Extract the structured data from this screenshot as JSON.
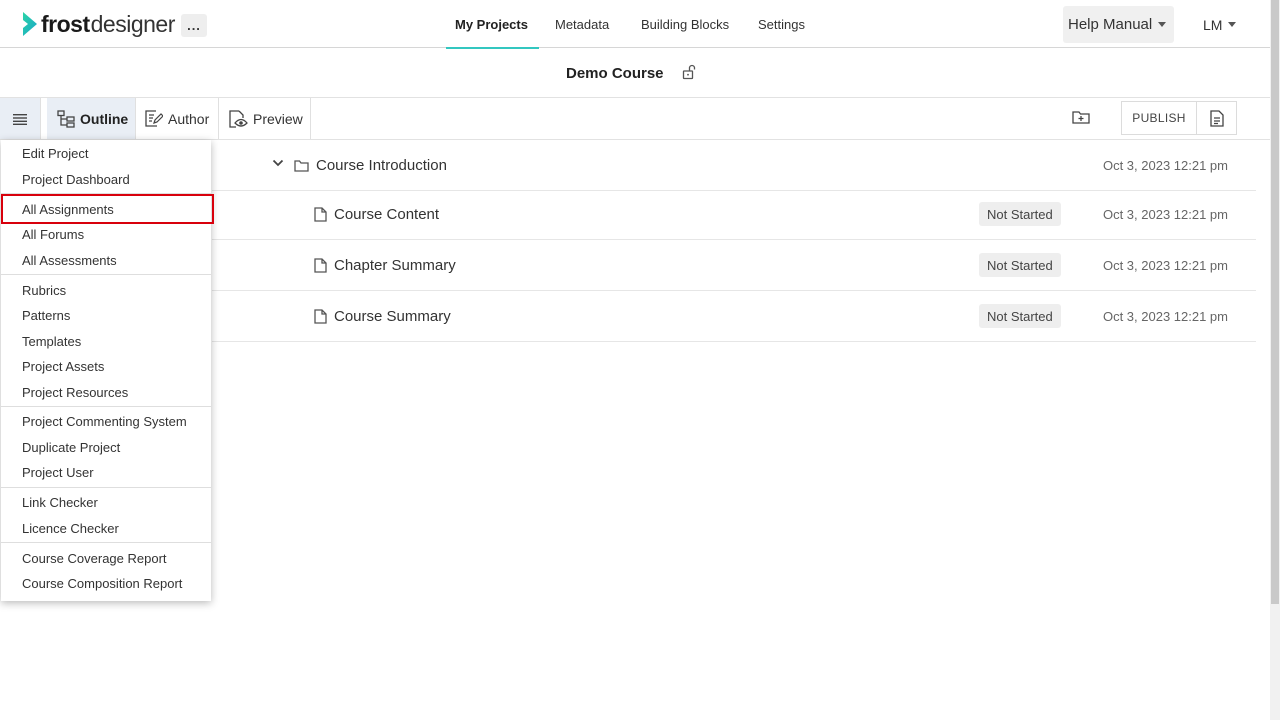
{
  "app": {
    "logo_bold": "frost",
    "logo_regular": "designer",
    "more_label": "...",
    "brand_accent": "#32c7c0"
  },
  "nav": {
    "items": [
      {
        "label": "My Projects",
        "active": true
      },
      {
        "label": "Metadata",
        "active": false
      },
      {
        "label": "Building Blocks",
        "active": false
      },
      {
        "label": "Settings",
        "active": false
      }
    ],
    "help_label": "Help Manual",
    "user_initials": "LM"
  },
  "course": {
    "title": "Demo Course",
    "lock_icon": "unlocked-padlock-icon"
  },
  "toolbar": {
    "tabs": [
      {
        "label": "Outline",
        "icon": "tree-structure-icon",
        "active": true
      },
      {
        "label": "Author",
        "icon": "edit-document-icon",
        "active": false
      },
      {
        "label": "Preview",
        "icon": "preview-eye-icon",
        "active": false
      }
    ],
    "publish_label": "PUBLISH"
  },
  "outline": {
    "rows": [
      {
        "type": "folder",
        "title": "Course Introduction",
        "status": "",
        "date": "Oct 3, 2023 12:21 pm"
      },
      {
        "type": "page",
        "title": "Course Content",
        "status": "Not Started",
        "date": "Oct 3, 2023 12:21 pm"
      },
      {
        "type": "page",
        "title": "Chapter Summary",
        "status": "Not Started",
        "date": "Oct 3, 2023 12:21 pm"
      },
      {
        "type": "page",
        "title": "Course Summary",
        "status": "Not Started",
        "date": "Oct 3, 2023 12:21 pm"
      }
    ]
  },
  "menu": {
    "items": [
      "Edit Project",
      "Project Dashboard",
      "All Assignments",
      "All Forums",
      "All Assessments",
      "Rubrics",
      "Patterns",
      "Templates",
      "Project Assets",
      "Project Resources",
      "Project Commenting System",
      "Duplicate Project",
      "Project User",
      "Link Checker",
      "Licence Checker",
      "Course Coverage Report",
      "Course Composition Report"
    ],
    "highlighted_item": "All Assignments",
    "highlight_color": "#d8000c"
  }
}
